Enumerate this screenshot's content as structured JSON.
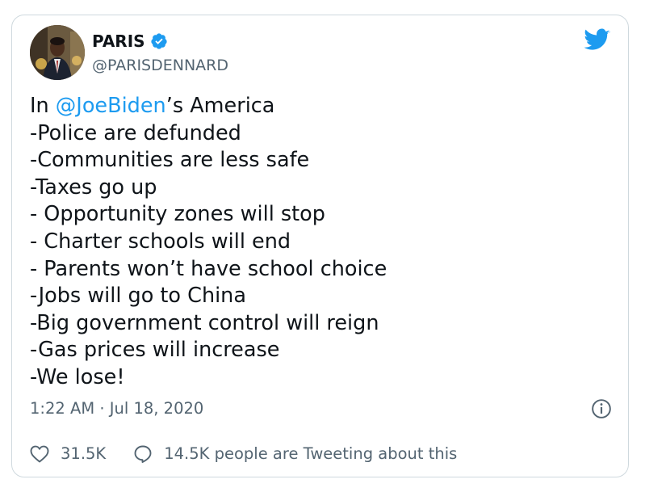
{
  "author": {
    "display_name": "PARIS",
    "handle": "@PARISDENNARD",
    "verified": true
  },
  "tweet": {
    "first_line": {
      "prefix": "In ",
      "mention": "@JoeBiden",
      "suffix": "’s America"
    },
    "lines": [
      "-Police are defunded",
      "-Communities are less safe",
      "-Taxes go up",
      "- Opportunity zones will stop",
      "- Charter schools will end",
      "- Parents won’t have school choice",
      "-Jobs will go to China",
      "-Big government control will reign",
      "-Gas prices will increase",
      "-We lose!"
    ],
    "timestamp": "1:22 AM · Jul 18, 2020"
  },
  "engagement": {
    "likes": "31.5K",
    "tweeting": "14.5K people are Tweeting about this"
  },
  "colors": {
    "accent": "#1d9bf0",
    "text": "#0f1419",
    "muted": "#536471",
    "border": "#cfd9de"
  },
  "icons": {
    "brand": "twitter-bird-icon",
    "verified": "verified-badge-icon",
    "info": "info-icon",
    "like": "heart-icon",
    "reply": "speech-bubble-icon"
  }
}
